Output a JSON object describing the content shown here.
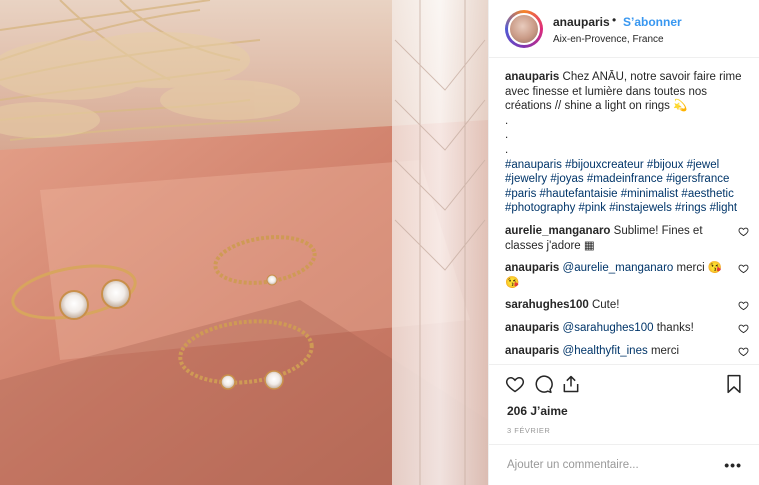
{
  "post": {
    "username": "anauparis",
    "separator": "•",
    "follow_label": "S’abonner",
    "location": "Aix-en-Provence, France"
  },
  "caption": {
    "username": "anauparis",
    "text": "Chez ANĀU, notre savoir faire rime avec finesse et lumière dans toutes nos créations // shine a light on rings 💫",
    "dots": [
      ".",
      ".",
      "."
    ],
    "hashtags": "#anauparis #bijouxcreateur #bijoux #jewel #jewelry #joyas #madeinfrance #igersfrance #paris #hautefantaisie #minimalist #aesthetic #photography #pink #instajewels #rings #light"
  },
  "comments": [
    {
      "user": "aurelie_manganaro",
      "mention": "",
      "text": "Sublime! Fines et classes j'adore ▦"
    },
    {
      "user": "anauparis",
      "mention": "@aurelie_manganaro",
      "text": "merci 😘😘"
    },
    {
      "user": "sarahughes100",
      "mention": "",
      "text": "Cute!"
    },
    {
      "user": "anauparis",
      "mention": "@sarahughes100",
      "text": "thanks!"
    },
    {
      "user": "anauparis",
      "mention": "@healthyfit_ines",
      "text": "merci"
    }
  ],
  "icons": {
    "like": "heart-icon",
    "comment": "comment-icon",
    "share": "share-icon",
    "save": "bookmark-icon",
    "comment_like": "heart-icon"
  },
  "likes_text": "206 J’aime",
  "date_text": "3 FÉVRIER",
  "add_comment": {
    "placeholder": "Ajouter un commentaire...",
    "more_label": "•••"
  },
  "colors": {
    "link": "#3897f0",
    "hashtag": "#003569",
    "muted": "#999999",
    "border": "#efefef"
  }
}
